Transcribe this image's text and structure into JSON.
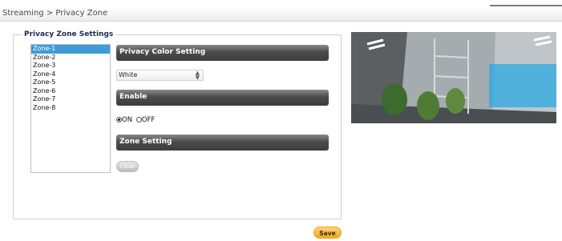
{
  "breadcrumb": {
    "text": "Streaming > Privacy Zone"
  },
  "settings": {
    "legend": "Privacy Zone Settings",
    "zones": [
      "Zone-1",
      "Zone-2",
      "Zone-3",
      "Zone-4",
      "Zone-5",
      "Zone-6",
      "Zone-7",
      "Zone-8"
    ],
    "selected_zone": "Zone-1",
    "privacy_color": {
      "title": "Privacy Color Setting",
      "selected": "White"
    },
    "enable": {
      "title": "Enable",
      "on_label": "ON",
      "off_label": "OFF",
      "value": "ON"
    },
    "zone_setting": {
      "title": "Zone Setting",
      "clear_label": "Clear"
    }
  },
  "actions": {
    "save_label": "Save"
  },
  "colors": {
    "selected_zone": "#3e9bd9",
    "section_bar": "#4b4b4b",
    "save_button": "#f5a623",
    "privacy_mask": "#2aa9e3"
  }
}
